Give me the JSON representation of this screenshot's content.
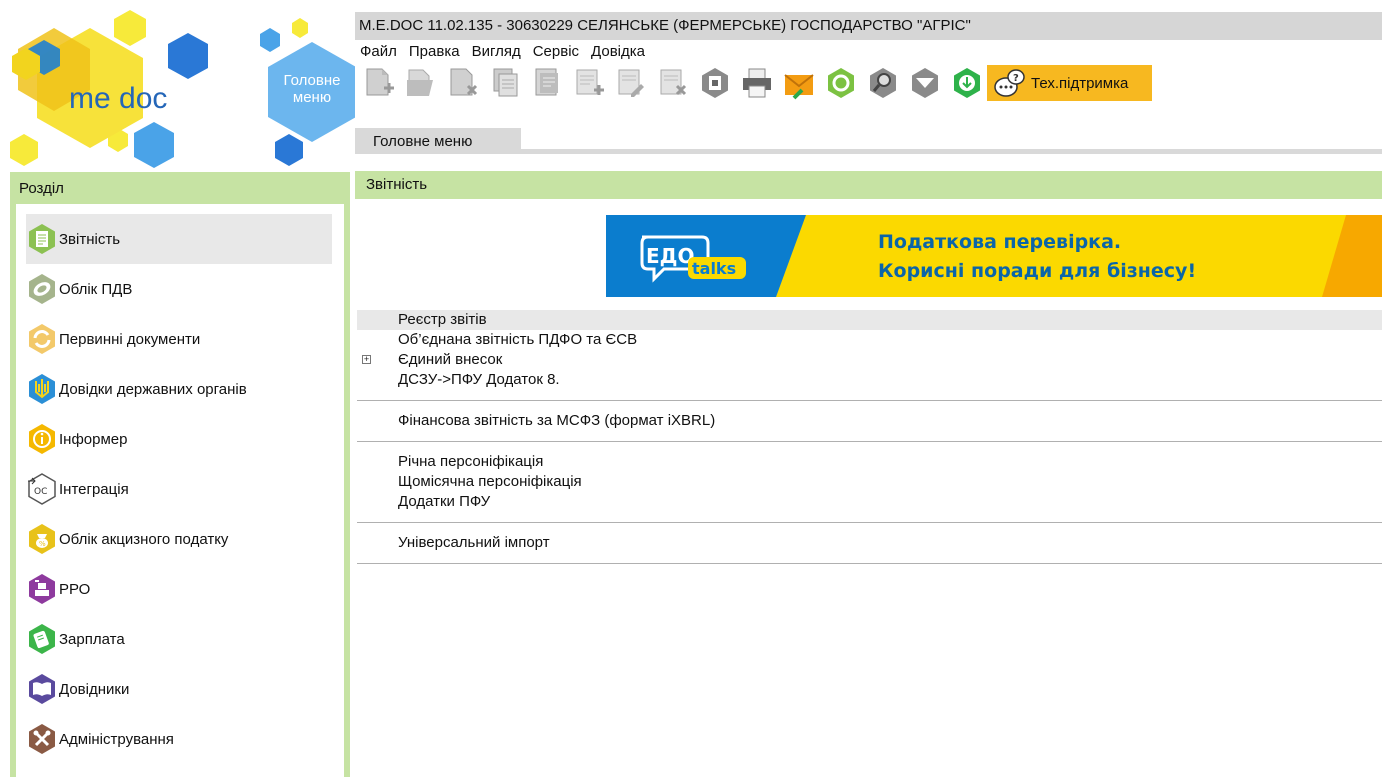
{
  "app": {
    "title": "M.E.DOC 11.02.135  - 30630229 СЕЛЯНСЬКЕ (ФЕРМЕРСЬКЕ) ГОСПОДАРСТВО \"АГРІС\"",
    "logo_text": "me doc",
    "main_menu_button": "Головне меню"
  },
  "menu": [
    "Файл",
    "Правка",
    "Вигляд",
    "Сервіс",
    "Довідка"
  ],
  "toolbar": {
    "buttons": [
      "new-doc-icon",
      "open-folder-icon",
      "delete-doc-icon",
      "copy-doc-icon",
      "properties-icon",
      "add-row-icon",
      "edit-row-icon",
      "delete-row-icon",
      "import-icon",
      "print-icon",
      "send-mail-icon",
      "refresh-status-icon",
      "search-icon",
      "filter-icon",
      "download-icon"
    ],
    "support_label": "Тех.підтримка"
  },
  "tab": {
    "label": "Головне меню"
  },
  "sidebar": {
    "header": "Розділ",
    "items": [
      {
        "label": "Звітність",
        "icon": "report-icon",
        "color": "#8cc152",
        "active": true
      },
      {
        "label": "Облік ПДВ",
        "icon": "vat-icon",
        "color": "#a5b48c",
        "active": false
      },
      {
        "label": "Первинні документи",
        "icon": "primary-docs-icon",
        "color": "#f3c96a",
        "active": false
      },
      {
        "label": "Довідки державних органів",
        "icon": "trident-icon",
        "color": "#2b8fd6",
        "active": false
      },
      {
        "label": "Інформер",
        "icon": "info-icon",
        "color": "#f5b800",
        "active": false
      },
      {
        "label": "Інтеграція",
        "icon": "integration-icon",
        "color": "#ffffff",
        "active": false
      },
      {
        "label": "Облік акцизного податку",
        "icon": "excise-icon",
        "color": "#e8c21a",
        "active": false
      },
      {
        "label": "РРО",
        "icon": "cash-register-icon",
        "color": "#8e3a9e",
        "active": false
      },
      {
        "label": "Зарплата",
        "icon": "salary-icon",
        "color": "#3cb54a",
        "active": false
      },
      {
        "label": "Довідники",
        "icon": "book-icon",
        "color": "#5a4a9e",
        "active": false
      },
      {
        "label": "Адміністрування",
        "icon": "tools-icon",
        "color": "#8a5a44",
        "active": false
      }
    ]
  },
  "content": {
    "header": "Звітність",
    "banner": {
      "logo_top": "ЕДО",
      "logo_bottom": "talks",
      "line1": "Податкова перевірка.",
      "line2": "Корисні поради для бізнесу!"
    },
    "groups": [
      {
        "rows": [
          {
            "label": "Реєстр звітів",
            "selected": true,
            "expander": false
          },
          {
            "label": "Об’єднана звітність ПДФО та ЄСВ",
            "selected": false,
            "expander": false
          },
          {
            "label": "Єдиний внесок",
            "selected": false,
            "expander": true
          },
          {
            "label": "ДСЗУ->ПФУ Додаток 8.",
            "selected": false,
            "expander": false
          }
        ]
      },
      {
        "rows": [
          {
            "label": "Фінансова звітність за МСФЗ (формат iXBRL)",
            "selected": false,
            "expander": false
          }
        ]
      },
      {
        "rows": [
          {
            "label": "Річна персоніфікація",
            "selected": false,
            "expander": false
          },
          {
            "label": "Щомісячна персоніфікація",
            "selected": false,
            "expander": false
          },
          {
            "label": "Додатки ПФУ",
            "selected": false,
            "expander": false
          }
        ]
      },
      {
        "rows": [
          {
            "label": "Універсальний імпорт",
            "selected": false,
            "expander": false
          }
        ]
      }
    ]
  }
}
